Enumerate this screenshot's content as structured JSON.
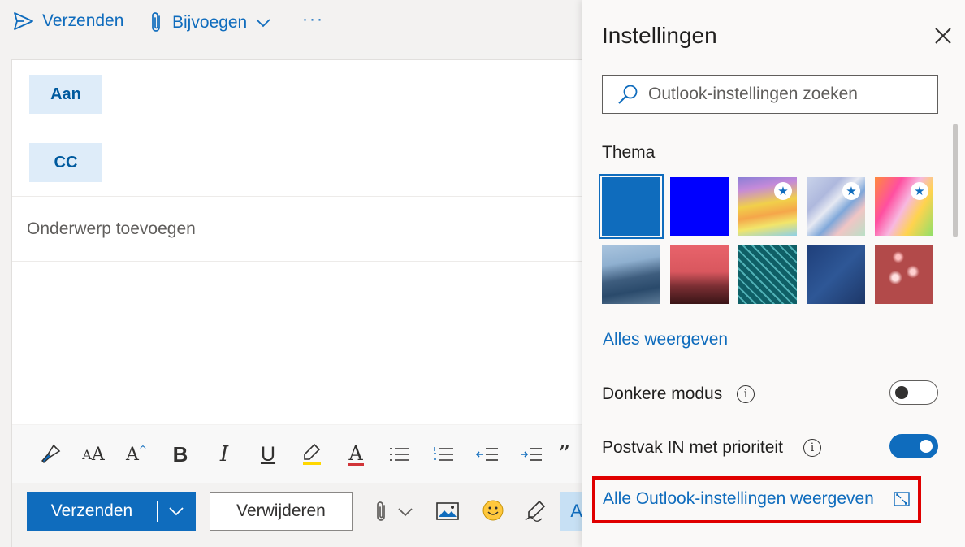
{
  "toolbar": {
    "send_label": "Verzenden",
    "attach_label": "Bijvoegen",
    "more_label": "···"
  },
  "compose": {
    "to_label": "Aan",
    "cc_label": "CC",
    "subject_placeholder": "Onderwerp toevoegen"
  },
  "format_icons": [
    "format-painter-icon",
    "font-size-icon",
    "grow-font-icon",
    "bold-icon",
    "italic-icon",
    "underline-icon",
    "highlight-icon",
    "font-color-icon",
    "bullets-icon",
    "numbering-icon",
    "decrease-indent-icon",
    "increase-indent-icon",
    "quote-icon"
  ],
  "actions": {
    "send_label": "Verzenden",
    "discard_label": "Verwijderen"
  },
  "settings": {
    "title": "Instellingen",
    "search_placeholder": "Outlook-instellingen zoeken",
    "theme_label": "Thema",
    "themes": [
      {
        "name": "blue",
        "color": "#0f6cbd",
        "selected": true,
        "premium": false
      },
      {
        "name": "bright-blue",
        "color": "#0000ff",
        "selected": false,
        "premium": false
      },
      {
        "name": "rainbow",
        "selected": false,
        "premium": true
      },
      {
        "name": "pastel-streamers",
        "selected": false,
        "premium": true
      },
      {
        "name": "unicorn",
        "selected": false,
        "premium": true
      },
      {
        "name": "mountain",
        "selected": false,
        "premium": false
      },
      {
        "name": "palm-sunset",
        "selected": false,
        "premium": false
      },
      {
        "name": "circuit",
        "selected": false,
        "premium": false
      },
      {
        "name": "innovation",
        "selected": false,
        "premium": false
      },
      {
        "name": "lights",
        "selected": false,
        "premium": false
      }
    ],
    "view_all_label": "Alles weergeven",
    "dark_mode_label": "Donkere modus",
    "dark_mode_on": false,
    "focused_inbox_label": "Postvak IN met prioriteit",
    "focused_inbox_on": true,
    "all_settings_label": "Alle Outlook-instellingen weergeven"
  },
  "colors": {
    "accent": "#0f6cbd",
    "highlight_box": "#e00000"
  }
}
